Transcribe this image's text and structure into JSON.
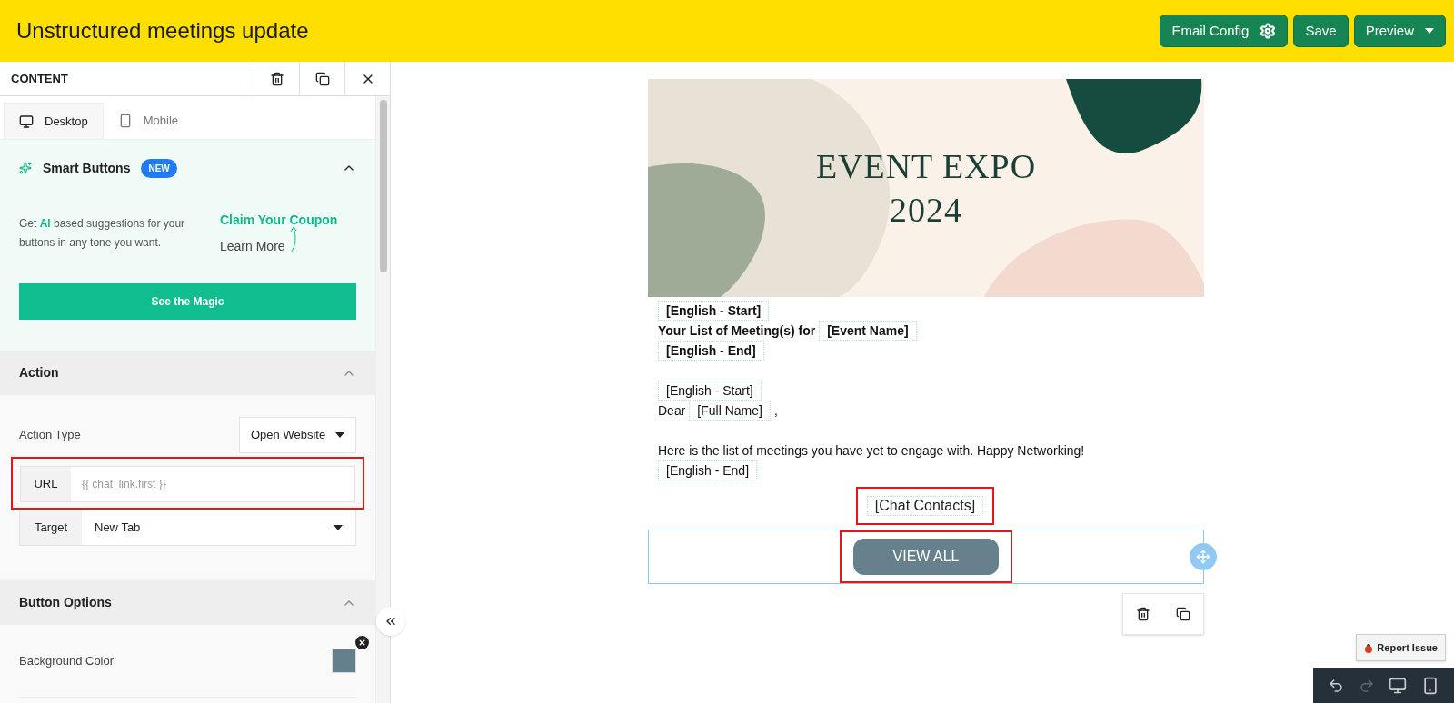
{
  "header": {
    "title": "Unstructured meetings update",
    "buttons": [
      {
        "label": "Email Config",
        "kind": "gear"
      },
      {
        "label": "Save",
        "kind": "plain"
      },
      {
        "label": "Preview",
        "kind": "dropdown"
      }
    ]
  },
  "panel": {
    "title": "CONTENT",
    "tabs": [
      {
        "label": "Desktop",
        "kind": "desktop",
        "selected": true
      },
      {
        "label": "Mobile",
        "kind": "mobile",
        "selected": false
      }
    ],
    "smart": {
      "title": "Smart Buttons",
      "badge": "NEW",
      "expanded": true,
      "text": "Get **AI** based suggestions for your buttons in any tone you want.",
      "claim": "Claim Your Coupon",
      "learn": "Learn More",
      "button": "See the Magic"
    },
    "action": {
      "title": "Action",
      "expanded": true,
      "type_label": "Action Type",
      "type_value": "Open Website",
      "url_label": "URL",
      "url_placeholder": "{{ chat_link.first }}",
      "target_label": "Target",
      "target_value": "New Tab"
    },
    "options": {
      "title": "Button Options",
      "expanded": true,
      "bg_label": "Background Color",
      "color": "#64808c"
    }
  },
  "email": {
    "banner": {
      "line1": "EVENT EXPO",
      "line2": "2024"
    },
    "lines": [
      {
        "kind": "tag",
        "bold": true,
        "parts": [
          "[English - Start]"
        ]
      },
      {
        "kind": "text_tag",
        "bold": true,
        "parts": [
          "Your List of Meeting(s) for",
          "[Event Name]"
        ]
      },
      {
        "kind": "tag",
        "bold": true,
        "parts": [
          "[English - End]"
        ]
      },
      {
        "kind": "gap"
      },
      {
        "kind": "tag",
        "bold": false,
        "parts": [
          "[English - Start]"
        ]
      },
      {
        "kind": "text_tag_text",
        "bold": false,
        "parts": [
          "Dear",
          "[Full Name]",
          ","
        ]
      },
      {
        "kind": "gap"
      },
      {
        "kind": "text",
        "bold": false,
        "parts": [
          "Here is the list of meetings you have yet to engage with. Happy Networking!"
        ]
      },
      {
        "kind": "tag",
        "bold": false,
        "parts": [
          "[English - End]"
        ]
      }
    ],
    "contacts": "[Chat Contacts]",
    "button": "VIEW ALL"
  },
  "report": "Report Issue"
}
